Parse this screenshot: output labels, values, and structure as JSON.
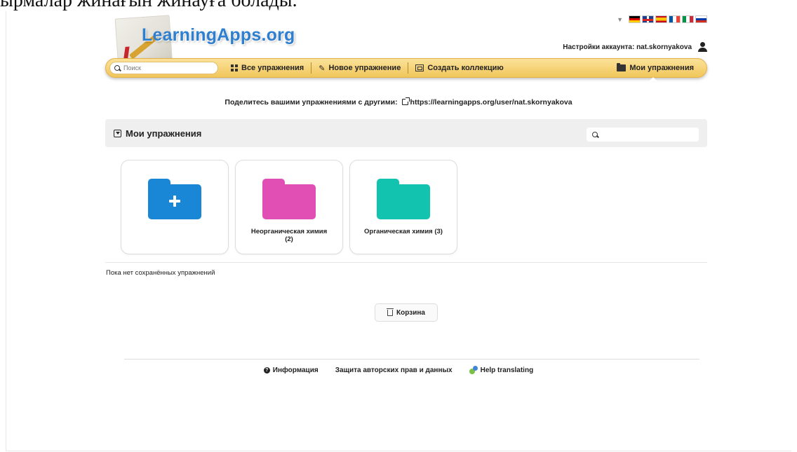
{
  "document": {
    "top_text": "ырмалар жинағын жинауға болады."
  },
  "header": {
    "logo_text": "LearningApps.org",
    "languages": [
      "de-flag-icon",
      "gb-flag-icon",
      "es-flag-icon",
      "fr-flag-icon",
      "it-flag-icon",
      "ru-flag-icon"
    ],
    "account_label": "Настройки аккаунта: nat.skornyakova"
  },
  "navbar": {
    "search_placeholder": "Поиск",
    "all_exercises": "Все упражнения",
    "new_exercise": "Новое упражнение",
    "create_collection": "Создать коллекцию",
    "my_exercises": "Мои упражнения"
  },
  "share": {
    "label": "Поделитесь вашими упражнениями с другими:",
    "url": "https://learningapps.org/user/nat.skornyakova"
  },
  "section": {
    "title": "Мои упражнения",
    "search_placeholder": ""
  },
  "folders": [
    {
      "label": "",
      "color": "#1a86d6",
      "kind": "new-folder"
    },
    {
      "label": "Неорганическая химия (2)",
      "color": "#e14fb4",
      "kind": "folder"
    },
    {
      "label": "Органическая химия (3)",
      "color": "#12c3b0",
      "kind": "folder"
    }
  ],
  "empty_note": "Пока нет сохранённых упражнений",
  "trash_label": "Корзина",
  "footer": {
    "info": "Информация",
    "copyright": "Защита авторских прав и данных",
    "help_translating": "Help translating"
  },
  "colors": {
    "navbar_accent": "#f1c65a",
    "logo_blue": "#2e7fd0"
  }
}
